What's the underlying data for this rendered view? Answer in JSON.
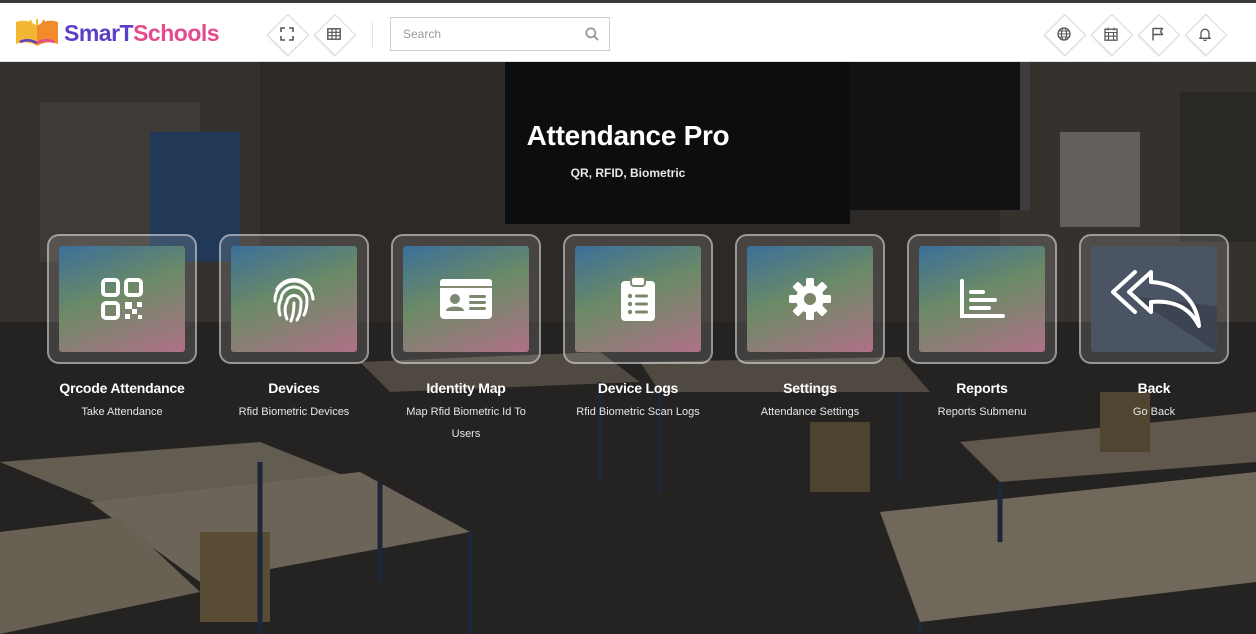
{
  "brand": {
    "part1": "SmarT",
    "part2": "Schools"
  },
  "toolbar": {
    "fullscreen_icon": "expand-icon",
    "apps_icon": "grid-icon",
    "right_icons": [
      "globe-icon",
      "calendar-icon",
      "flag-icon",
      "bell-icon"
    ]
  },
  "search": {
    "placeholder": "Search",
    "value": ""
  },
  "hero": {
    "title": "Attendance Pro",
    "subtitle": "QR, RFID, Biometric"
  },
  "tiles": [
    {
      "label": "Qrcode Attendance",
      "desc": "Take Attendance",
      "icon": "qrcode-icon"
    },
    {
      "label": "Devices",
      "desc": "Rfid Biometric Devices",
      "icon": "fingerprint-icon"
    },
    {
      "label": "Identity Map",
      "desc": "Map Rfid Biometric Id To Users",
      "icon": "id-card-icon"
    },
    {
      "label": "Device Logs",
      "desc": "Rfid Biometric Scan Logs",
      "icon": "clipboard-list-icon"
    },
    {
      "label": "Settings",
      "desc": "Attendance Settings",
      "icon": "gear-icon"
    },
    {
      "label": "Reports",
      "desc": "Reports Submenu",
      "icon": "bar-chart-icon"
    },
    {
      "label": "Back",
      "desc": "Go Back",
      "icon": "reply-all-icon"
    }
  ],
  "colors": {
    "tile_gradient_top": "#3b6f9a",
    "tile_gradient_mid": "#6b8a66",
    "tile_gradient_bottom": "#b07188",
    "back_tile": "#4b5463",
    "brand_purple": "#5b3fc4",
    "brand_pink": "#e24b8e"
  }
}
